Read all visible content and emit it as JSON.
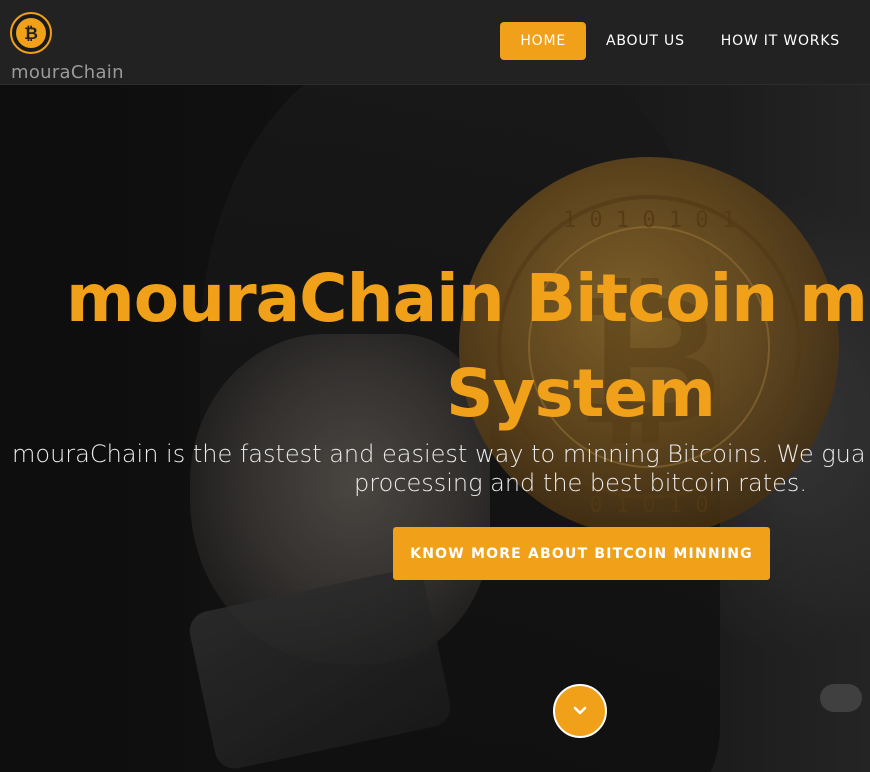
{
  "brand": {
    "name": "mouraChain",
    "logo_icon": "bitcoin-logo-icon",
    "logo_color": "#f0a019"
  },
  "nav": {
    "items": [
      {
        "label": "HOME",
        "active": true
      },
      {
        "label": "ABOUT US",
        "active": false
      },
      {
        "label": "HOW IT WORKS",
        "active": false
      }
    ]
  },
  "hero": {
    "headline_line1": "mouraChain Bitcoin m",
    "headline_line2": "System",
    "tagline_line1": "mouraChain is the fastest and easiest way to minning Bitcoins. We gua",
    "tagline_line2": "processing and the best bitcoin rates.",
    "cta_label": "KNOW MORE ABOUT BITCOIN MINNING",
    "scroll_icon": "chevron-down-icon",
    "background_image": "hand-holding-bitcoin-coin"
  },
  "colors": {
    "accent": "#f0a019",
    "navbar": "#222222",
    "text_light": "#ececec"
  }
}
